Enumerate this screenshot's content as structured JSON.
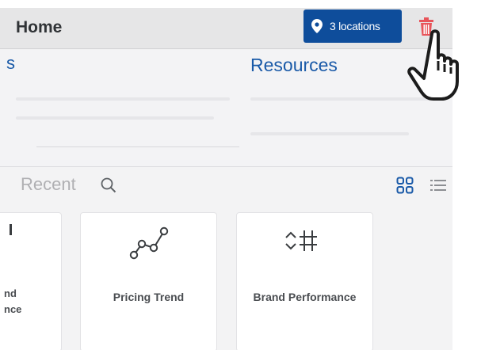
{
  "header": {
    "title": "Home",
    "locations_label": "3 locations"
  },
  "resources": {
    "partial_left_text": "s",
    "title": "Resources"
  },
  "recent": {
    "label": "Recent"
  },
  "cards": [
    {
      "label_line1": "nd",
      "label_line2": "nce"
    },
    {
      "label": "Pricing Trend"
    },
    {
      "label": "Brand Performance"
    }
  ],
  "icons": {
    "location": "map-pin-icon",
    "delete": "trash-icon",
    "search": "search-icon",
    "grid_view": "grid-view-icon",
    "list_view": "list-view-icon",
    "pricing_trend": "line-chart-icon",
    "brand_performance": "sort-hash-icon",
    "pointer": "hand-pointer-icon"
  },
  "colors": {
    "accent_blue": "#0e4d9b",
    "link_blue": "#1a5aa8",
    "delete_red": "#e8545a",
    "header_bg": "#e6e6e7"
  }
}
